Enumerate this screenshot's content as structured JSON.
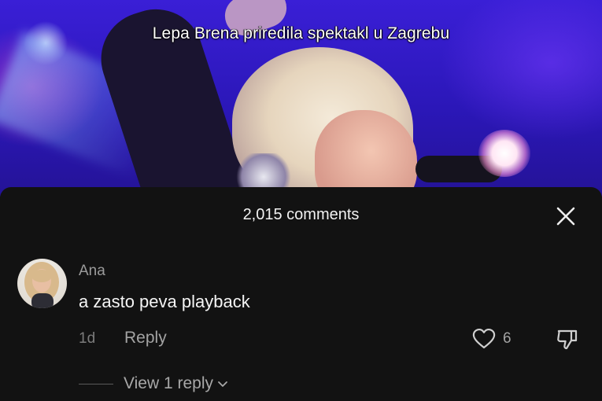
{
  "video": {
    "caption": "Lepa Brena priredila spektakl u Zagrebu"
  },
  "comments_panel": {
    "count_label": "2,015 comments",
    "close_icon": "close-icon",
    "comments": [
      {
        "username": "Ana",
        "text": "a zasto peva playback",
        "time": "1d",
        "reply_label": "Reply",
        "like_count": "6",
        "view_replies_label": "View 1 reply"
      }
    ]
  },
  "icons": [
    "close-icon",
    "heart-icon",
    "thumbs-down-icon",
    "chevron-down-icon"
  ],
  "colors": {
    "sheet_bg": "#121212",
    "primary_text": "#f5f5f5",
    "secondary_text": "#a3a3a3",
    "video_bg": "#2b17b8"
  }
}
